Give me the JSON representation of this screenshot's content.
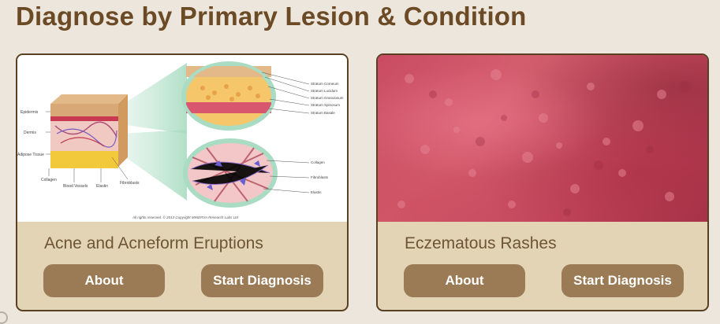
{
  "page": {
    "title": "Diagnose by Primary Lesion & Condition"
  },
  "cards": [
    {
      "title": "Acne and Acneform Eruptions",
      "about_label": "About",
      "start_label": "Start Diagnosis",
      "image": {
        "left_labels": [
          "Epidermis",
          "Dermis",
          "Adipose Tissue"
        ],
        "bottom_labels": [
          "Collagen",
          "Blood Vessels",
          "Elastin",
          "Fibroblasts"
        ],
        "top_zoom_labels": [
          "Stratum Corneum",
          "Stratum Lucidum",
          "Stratum Granulosum",
          "Stratum Spinosum",
          "Stratum Basale"
        ],
        "bottom_zoom_labels": [
          "Collagen",
          "Fibroblasts",
          "Elastin"
        ],
        "copyright": "All rights reserved. © 2013 Copyright MINERVA Research Labs Ltd"
      }
    },
    {
      "title": "Eczematous Rashes",
      "about_label": "About",
      "start_label": "Start Diagnosis"
    }
  ],
  "colors": {
    "background": "#ece6dc",
    "title": "#6b4a25",
    "card_body": "#e3d4b5",
    "button": "#9a7b55",
    "card_border": "#5a3f22"
  }
}
